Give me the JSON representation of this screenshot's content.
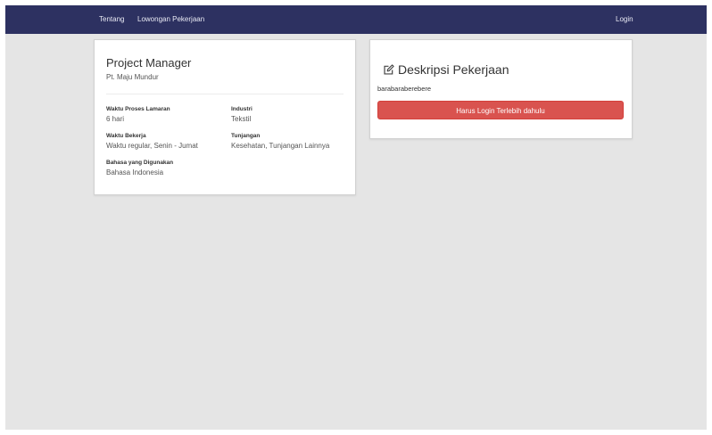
{
  "navbar": {
    "links": [
      {
        "label": "Tentang"
      },
      {
        "label": "Lowongan Pekerjaan"
      }
    ],
    "login_label": "Login"
  },
  "job": {
    "title": "Project Manager",
    "company": "Pt. Maju Mundur",
    "fields": {
      "process_time": {
        "label": "Waktu Proses Lamaran",
        "value": "6 hari"
      },
      "industry": {
        "label": "Industri",
        "value": "Tekstil"
      },
      "work_time": {
        "label": "Waktu Bekerja",
        "value": "Waktu regular, Senin - Jumat"
      },
      "benefits": {
        "label": "Tunjangan",
        "value": "Kesehatan, Tunjangan Lainnya"
      },
      "language": {
        "label": "Bahasa yang Digunakan",
        "value": "Bahasa Indonesia"
      }
    }
  },
  "description": {
    "icon": "edit-icon",
    "title": "Deskripsi Pekerjaan",
    "text": "barabaraberebere",
    "button_label": "Harus Login Terlebih dahulu",
    "button_color": "#d9534f"
  },
  "colors": {
    "navbar": "#2d3161",
    "page_background": "#e5e5e5"
  }
}
